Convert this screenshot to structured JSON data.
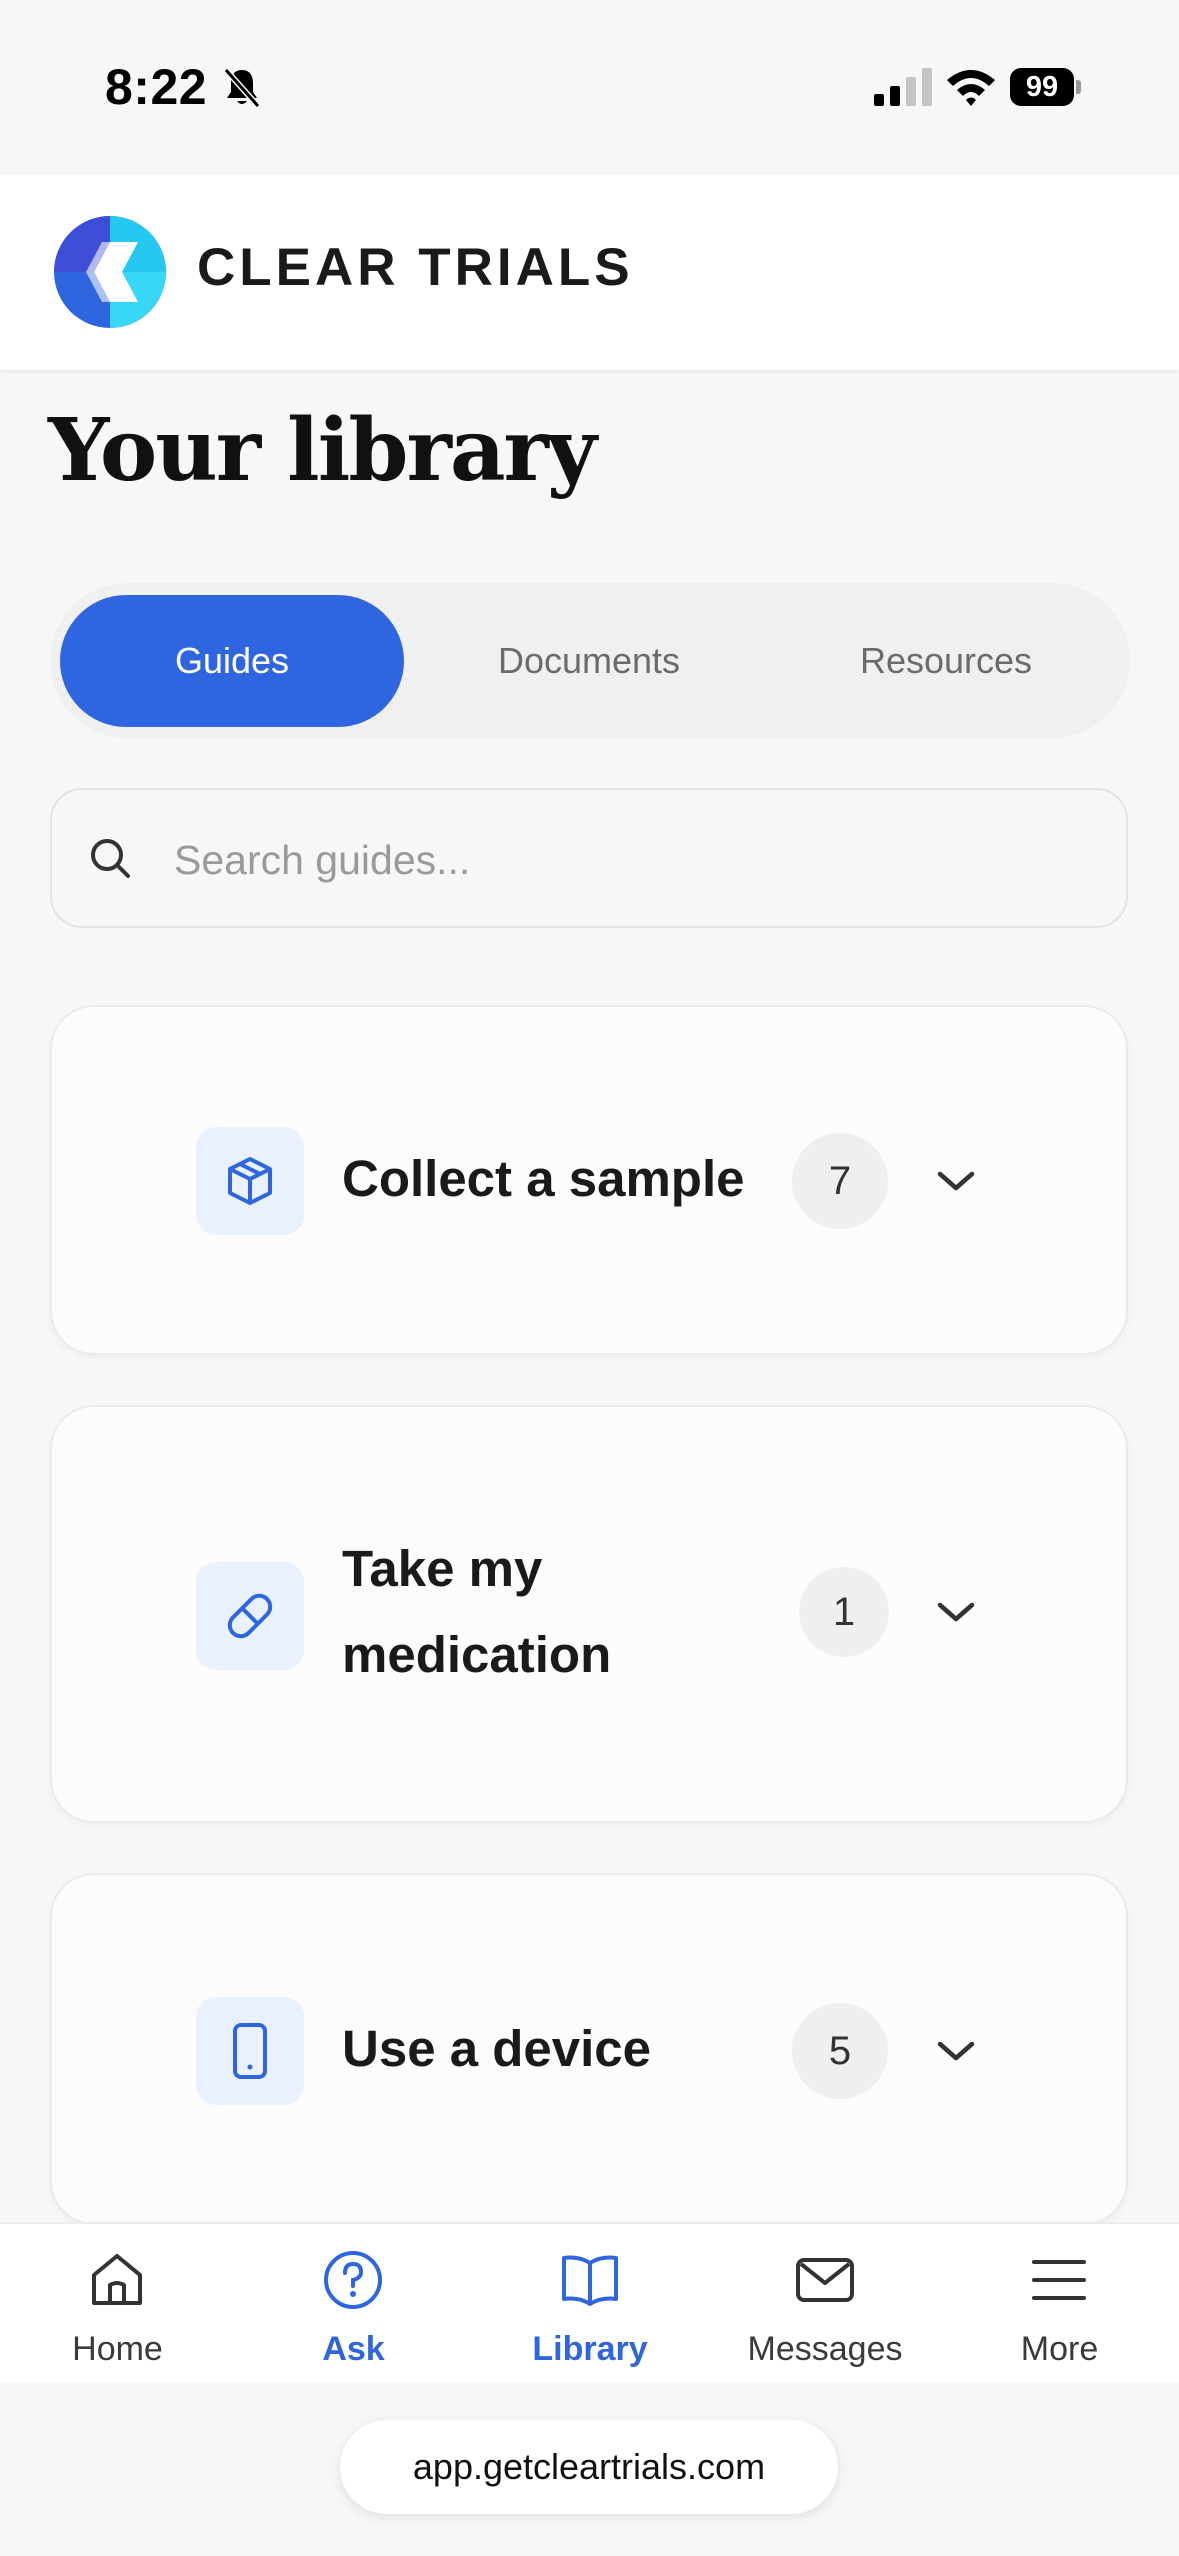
{
  "status_bar": {
    "time": "8:22",
    "battery": "99"
  },
  "header": {
    "brand": "CLEAR TRIALS"
  },
  "page": {
    "title": "Your library"
  },
  "tabs": [
    {
      "label": "Guides",
      "active": true
    },
    {
      "label": "Documents",
      "active": false
    },
    {
      "label": "Resources",
      "active": false
    }
  ],
  "search": {
    "placeholder": "Search guides...",
    "value": ""
  },
  "guides": [
    {
      "title": "Collect a sample",
      "count": "7",
      "icon": "box-icon"
    },
    {
      "title": "Take my medication",
      "count": "1",
      "icon": "pill-icon"
    },
    {
      "title": "Use a device",
      "count": "5",
      "icon": "phone-device-icon"
    }
  ],
  "nav": [
    {
      "label": "Home",
      "icon": "home-icon",
      "active": false
    },
    {
      "label": "Ask",
      "icon": "question-icon",
      "active": true
    },
    {
      "label": "Library",
      "icon": "book-icon",
      "active": true
    },
    {
      "label": "Messages",
      "icon": "mail-icon",
      "active": false
    },
    {
      "label": "More",
      "icon": "menu-icon",
      "active": false
    }
  ],
  "browser": {
    "url": "app.getcleartrials.com"
  },
  "colors": {
    "accent": "#2f66e0",
    "icon_bg": "#eaf1fe"
  }
}
